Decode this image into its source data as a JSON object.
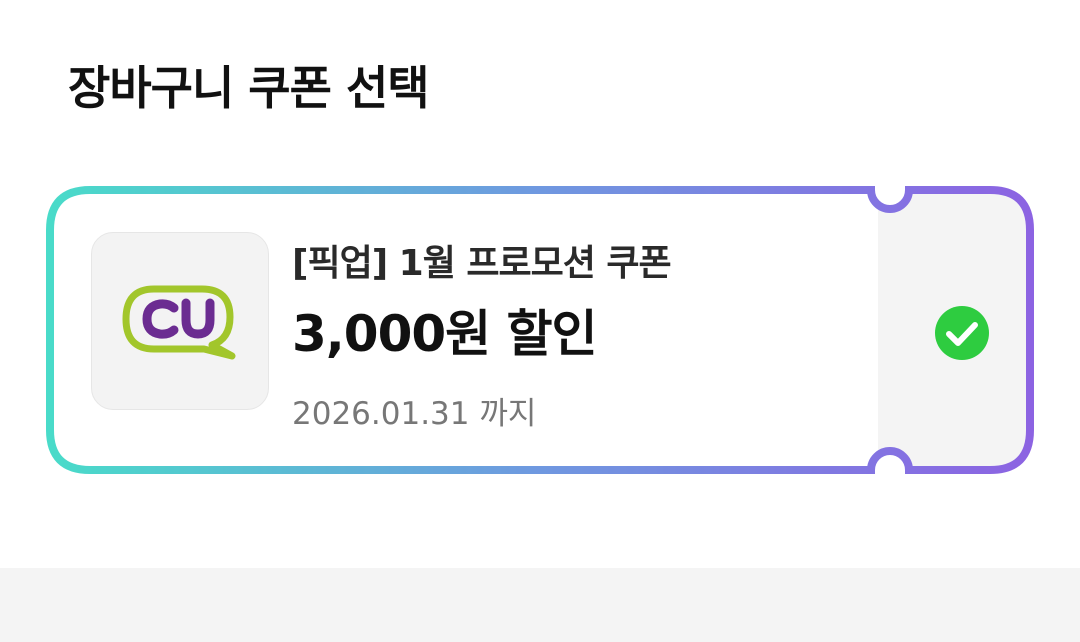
{
  "header": {
    "title": "장바구니 쿠폰 선택"
  },
  "coupon": {
    "brand_icon": "cu-logo",
    "brand_text": "CU",
    "name": "[픽업] 1월 프로모션 쿠폰",
    "amount": "3,000원 할인",
    "expiry": "2026.01.31 까지",
    "selected": true,
    "selected_icon": "check-circle-icon"
  },
  "colors": {
    "border_start": "#49dbc9",
    "border_end": "#8c63e2",
    "check_green": "#2ecc40",
    "cu_green": "#a2c62b",
    "cu_purple": "#6b2c91",
    "selected_panel": "#f4f4f4"
  }
}
